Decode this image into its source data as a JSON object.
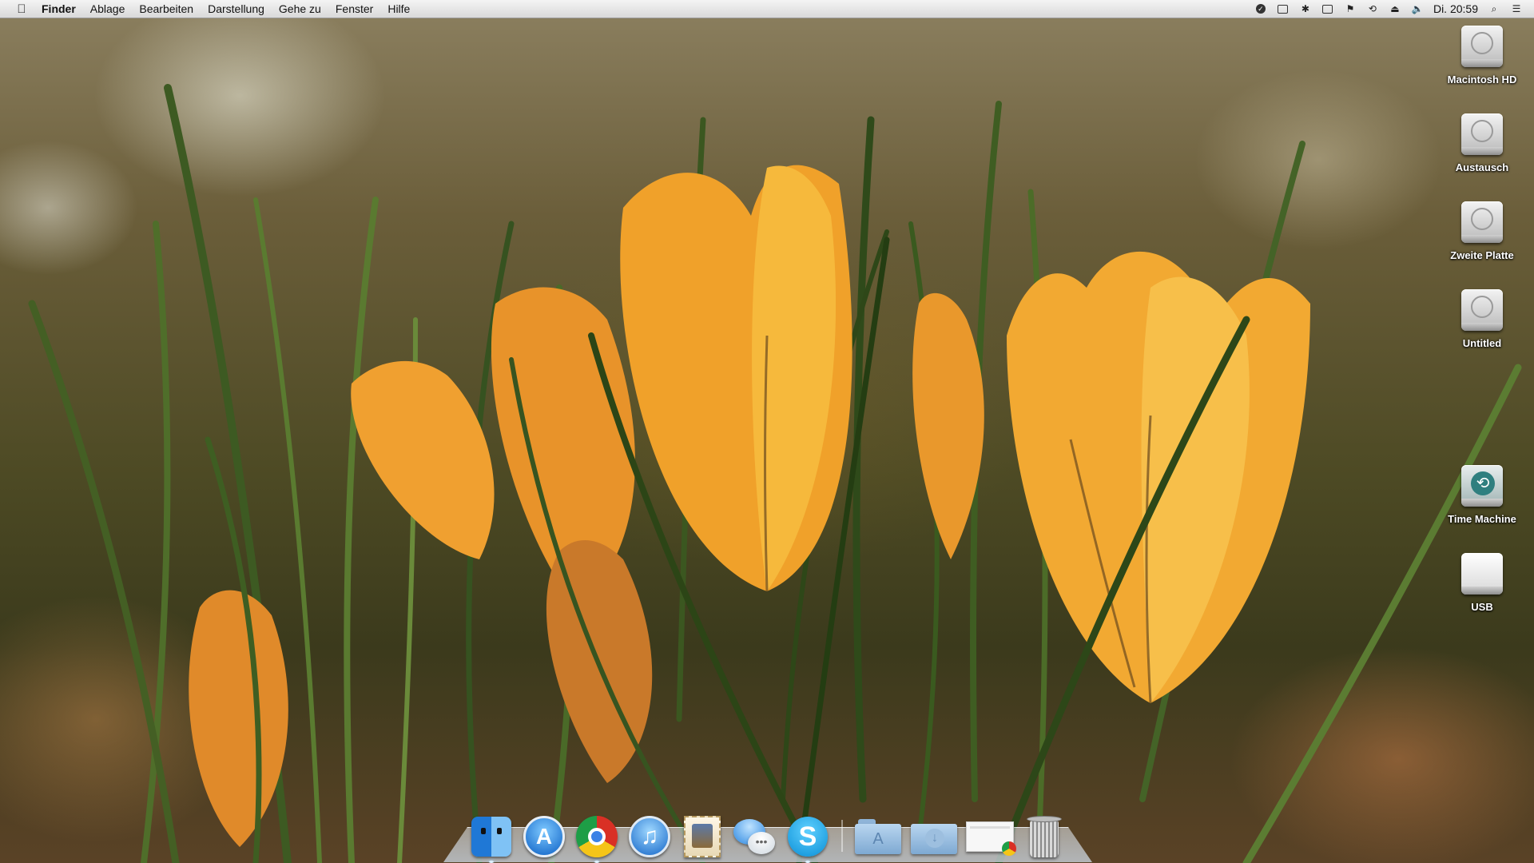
{
  "menubar": {
    "apple_icon": "apple-icon",
    "app_name": "Finder",
    "menus": [
      "Ablage",
      "Bearbeiten",
      "Darstellung",
      "Gehe zu",
      "Fenster",
      "Hilfe"
    ],
    "clock": "Di. 20:59",
    "status_icons": [
      "dropbox-icon",
      "display-icon",
      "bluetooth-icon",
      "battery-icon",
      "flag-icon",
      "time-machine-icon",
      "eject-icon",
      "volume-icon"
    ],
    "search_icon": "spotlight-search-icon",
    "notification_icon": "notification-center-icon"
  },
  "desktop": {
    "icons": [
      {
        "label": "Macintosh HD",
        "type": "hard-drive-icon"
      },
      {
        "label": "Austausch",
        "type": "hard-drive-icon"
      },
      {
        "label": "Zweite Platte",
        "type": "hard-drive-icon"
      },
      {
        "label": "Untitled",
        "type": "hard-drive-icon"
      },
      {
        "label": "Time Machine",
        "type": "time-machine-drive-icon"
      },
      {
        "label": "USB",
        "type": "usb-drive-icon"
      }
    ]
  },
  "dock": {
    "apps": [
      "finder-icon",
      "app-store-icon",
      "chrome-icon",
      "itunes-icon",
      "mail-icon",
      "messages-icon",
      "skype-icon"
    ],
    "stacks": [
      "applications-folder-icon",
      "downloads-folder-icon",
      "documents-stack-icon",
      "trash-icon"
    ]
  }
}
